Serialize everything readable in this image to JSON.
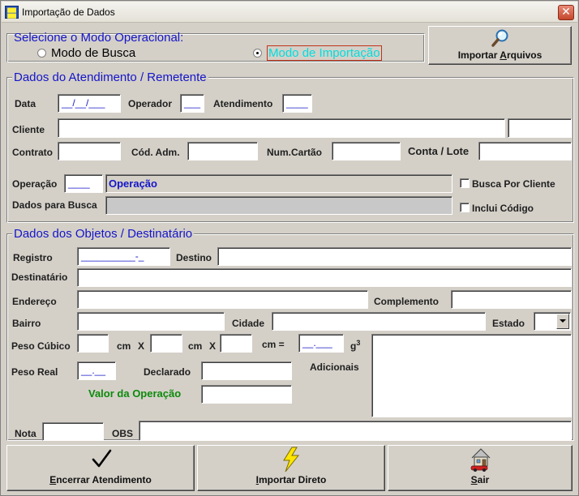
{
  "window": {
    "title": "Importação de Dados",
    "icon": "app-icon",
    "close": "✕"
  },
  "modo": {
    "title": "Selecione o Modo Operacional:",
    "option_busca": "Modo de Busca",
    "option_importacao": "Modo de Importação",
    "selected": "Modo de Importação"
  },
  "importar_arquivos": {
    "pre": "Importar ",
    "u": "A",
    "post": "rquivos",
    "icon": "magnifier-icon"
  },
  "atendimento": {
    "title": "Dados do Atendimento / Remetente",
    "data_label": "Data",
    "data_value": "__/__/___",
    "operador_label": "Operador",
    "operador_value": "___",
    "atendimento_label": "Atendimento",
    "atendimento_value": "____",
    "cliente_label": "Cliente",
    "contrato_label": "Contrato",
    "cod_adm_label": "Cód. Adm.",
    "num_cartao_label": "Num.Cartão",
    "conta_lote_label": "Conta / Lote",
    "operacao_label": "Operação",
    "operacao_code": "____",
    "operacao_desc": "Operação",
    "dados_busca_label": "Dados para Busca",
    "busca_por_cliente": "Busca Por Cliente",
    "inclui_codigo": "Inclui Código"
  },
  "objetos": {
    "title": "Dados dos Objetos / Destinatário",
    "registro_label": "Registro",
    "registro_value": "__________-_",
    "destino_label": "Destino",
    "destinatario_label": "Destinatário",
    "endereco_label": "Endereço",
    "complemento_label": "Complemento",
    "bairro_label": "Bairro",
    "cidade_label": "Cidade",
    "estado_label": "Estado",
    "peso_cubico_label": "Peso Cúbico",
    "cm1": "cm",
    "x1": "X",
    "cm2": "cm",
    "x2": "X",
    "cm_eq": "cm =",
    "volume_value": "__.___",
    "g3": "g",
    "g3_sup": "3",
    "peso_real_label": "Peso Real",
    "peso_real_value": "__.__",
    "declarado_label": "Declarado",
    "adicionais_label": "Adicionais",
    "valor_operacao_label": "Valor da Operação",
    "nota_label": "Nota",
    "obs_label": "OBS"
  },
  "buttons": {
    "encerrar": {
      "u": "E",
      "rest": "ncerrar Atendimento",
      "icon": "checkmark-icon"
    },
    "importar_direto": {
      "pre": "",
      "u": "I",
      "rest": "mportar Direto",
      "icon": "lightning-icon"
    },
    "sair": {
      "u": "S",
      "rest": "air",
      "icon": "house-car-icon"
    }
  },
  "colors": {
    "group_title": "#1515c8",
    "highlight": "#00e5e5",
    "green": "#0d8a0d"
  }
}
